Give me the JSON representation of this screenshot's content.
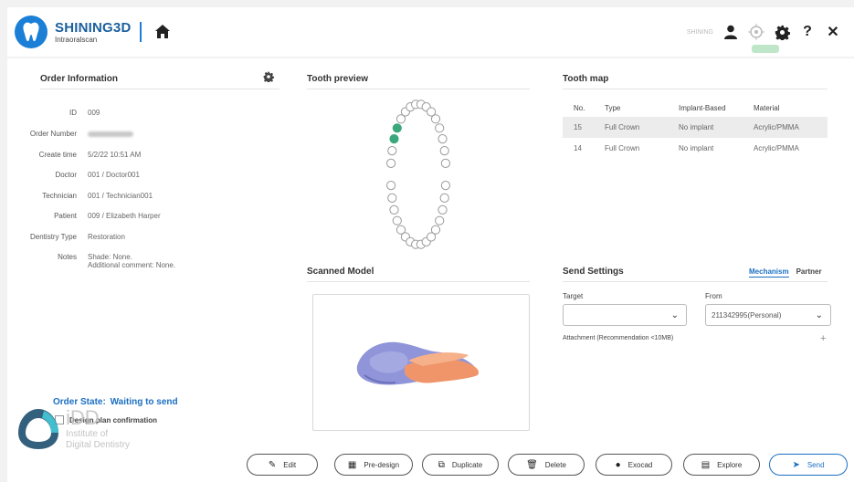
{
  "header": {
    "brand_name": "SHINING3D",
    "brand_sub": "Intraoralscan",
    "user_name": "SHINING"
  },
  "order_info": {
    "title": "Order Information",
    "fields": [
      {
        "label": "ID",
        "value": "009"
      },
      {
        "label": "Order Number",
        "value": ""
      },
      {
        "label": "Create time",
        "value": "5/2/22 10:51 AM"
      },
      {
        "label": "Doctor",
        "value": "001 / Doctor001"
      },
      {
        "label": "Technician",
        "value": "001 / Technician001"
      },
      {
        "label": "Patient",
        "value": "009 / Elizabeth Harper"
      },
      {
        "label": "Dentistry Type",
        "value": "Restoration"
      },
      {
        "label": "Notes",
        "value": "Shade: None.",
        "value2": "Additional comment: None."
      }
    ]
  },
  "tooth_preview": {
    "title": "Tooth preview"
  },
  "tooth_map": {
    "title": "Tooth map",
    "columns": [
      "No.",
      "Type",
      "Implant-Based",
      "Material"
    ],
    "rows": [
      {
        "no": "15",
        "type": "Full Crown",
        "implant": "No implant",
        "material": "Acrylic/PMMA"
      },
      {
        "no": "14",
        "type": "Full Crown",
        "implant": "No implant",
        "material": "Acrylic/PMMA"
      }
    ]
  },
  "scanned_model": {
    "title": "Scanned Model"
  },
  "send_settings": {
    "title": "Send Settings",
    "tabs": [
      "Mechanism",
      "Partner"
    ],
    "target_label": "Target",
    "target_value": "",
    "from_label": "From",
    "from_value": "211342995(Personal)",
    "attachment_label": "Attachment (Recommendation <10MB)",
    "add_symbol": "+"
  },
  "order_state": {
    "label": "Order State:",
    "value": "Waiting to send"
  },
  "design_confirmation": "Design plan confirmation",
  "watermark": {
    "big": "iDD",
    "line1": "Institute of",
    "line2": "Digital Dentistry"
  },
  "buttons": {
    "edit": "Edit",
    "predesign": "Pre-design",
    "duplicate": "Duplicate",
    "delete": "Delete",
    "exocad": "Exocad",
    "explore": "Explore",
    "send": "Send"
  },
  "colors": {
    "accent": "#1b6fc2",
    "brand": "#1b7fd6",
    "selected_tooth": "#3aa87a",
    "model_blue": "#8f95d8",
    "model_orange": "#f0956a"
  },
  "icons": {
    "home": "home-icon",
    "user": "user-icon",
    "crosshair": "crosshair-icon",
    "settings": "gear-icon",
    "help": "help-icon",
    "close": "close-icon"
  }
}
